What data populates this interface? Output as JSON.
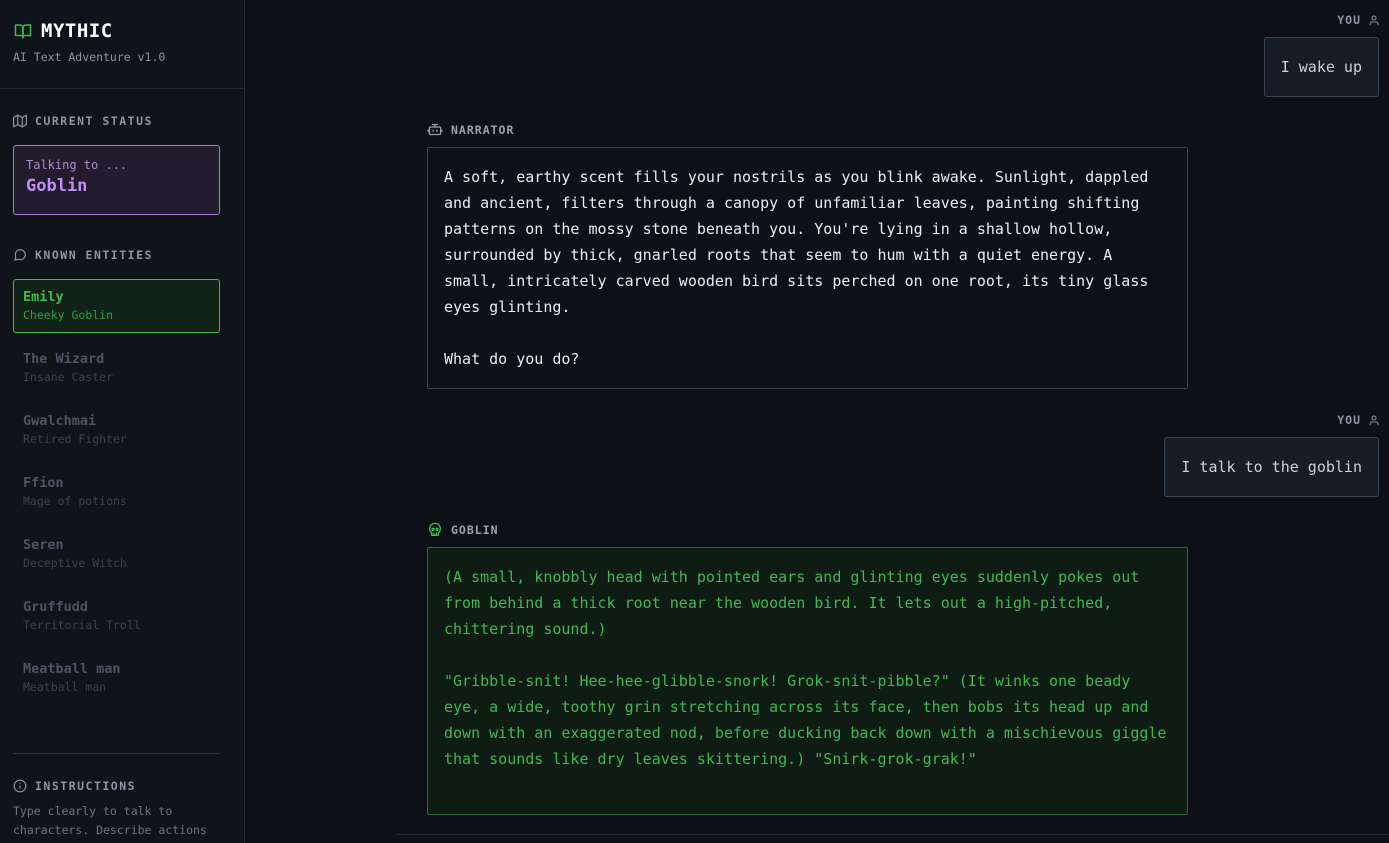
{
  "app": {
    "title": "MYTHIC",
    "subtitle": "AI Text Adventure v1.0"
  },
  "status": {
    "heading": "CURRENT STATUS",
    "label": "Talking to ...",
    "target": "Goblin"
  },
  "entities": {
    "heading": "KNOWN ENTITIES",
    "items": [
      {
        "name": "Emily",
        "role": "Cheeky Goblin",
        "active": true
      },
      {
        "name": "The Wizard",
        "role": "Insane Caster",
        "active": false
      },
      {
        "name": "Gwalchmai",
        "role": "Retired Fighter",
        "active": false
      },
      {
        "name": "Ffion",
        "role": "Mage of potions",
        "active": false
      },
      {
        "name": "Seren",
        "role": "Deceptive Witch",
        "active": false
      },
      {
        "name": "Gruffudd",
        "role": "Territorial Troll",
        "active": false
      },
      {
        "name": "Meatball man",
        "role": "Meatball man",
        "active": false
      }
    ]
  },
  "instructions": {
    "heading": "INSTRUCTIONS",
    "text": "Type clearly to talk to characters. Describe actions"
  },
  "chat": [
    {
      "speaker": "YOU",
      "text": "I wake up"
    },
    {
      "speaker": "NARRATOR",
      "text": "A soft, earthy scent fills your nostrils as you blink awake. Sunlight, dappled and ancient, filters through a canopy of unfamiliar leaves, painting shifting patterns on the mossy stone beneath you. You're lying in a shallow hollow, surrounded by thick, gnarled roots that seem to hum with a quiet energy. A small, intricately carved wooden bird sits perched on one root, its tiny glass eyes glinting.\n\nWhat do you do?"
    },
    {
      "speaker": "YOU",
      "text": "I talk to the goblin"
    },
    {
      "speaker": "GOBLIN",
      "text": "(A small, knobbly head with pointed ears and glinting eyes suddenly pokes out from behind a thick root near the wooden bird. It lets out a high-pitched, chittering sound.)\n\n\"Gribble-snit! Hee-hee-glibble-snork! Grok-snit-pibble?\" (It winks one beady eye, a wide, toothy grin stretching across its face, then bobs its head up and down with an exaggerated nod, before ducking back down with a mischievous giggle that sounds like dry leaves skittering.) \"Snirk-grok-grak!\""
    }
  ],
  "colors": {
    "accent_green": "#3fb950",
    "accent_purple": "#c38cf7",
    "background": "#0d1117"
  },
  "icons": {
    "brand": "book-open-icon",
    "status": "map-icon",
    "entities": "message-circle-icon",
    "instructions": "info-icon",
    "user": "user-icon",
    "narrator": "bot-icon",
    "goblin": "skull-icon"
  }
}
